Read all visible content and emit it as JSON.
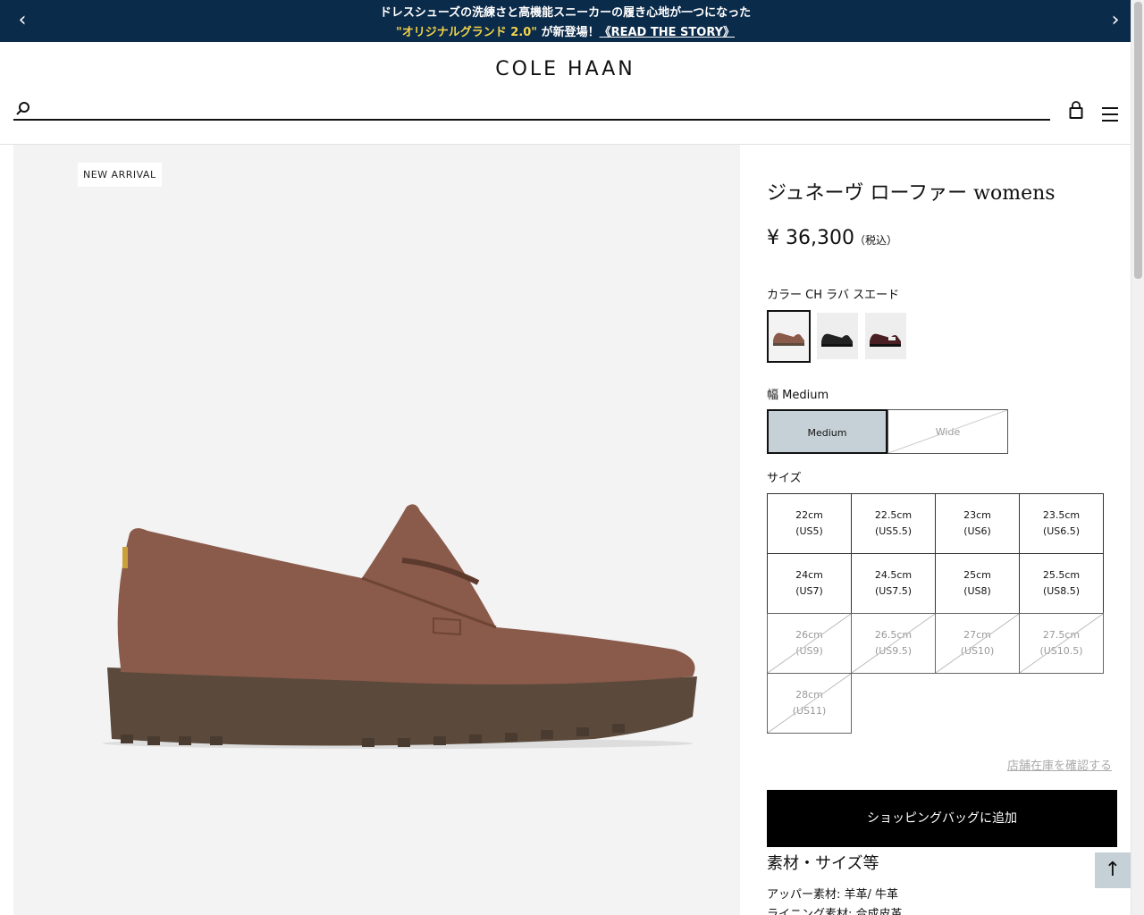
{
  "announcement": {
    "line1": "ドレスシューズの洗練さと高機能スニーカーの履き心地が一つになった",
    "highlight": "\"オリジナルグランド 2.0\"",
    "suffix": " が新登場！",
    "story_link": "《READ THE STORY》",
    "prev_icon": "chevron-left-icon",
    "next_icon": "chevron-right-icon"
  },
  "header": {
    "logo": "COLE HAAN",
    "search_placeholder": "",
    "icons": [
      "search-icon",
      "bag-icon",
      "menu-icon"
    ]
  },
  "gallery": {
    "badge": "NEW ARRIVAL"
  },
  "product": {
    "title": "ジュネーヴ ローファー womens",
    "price": "¥ 36,300",
    "tax_note": "（税込）",
    "color_label": "カラー CH ラバ スエード",
    "swatches": [
      {
        "name": "CH ラバ スエード",
        "selected": true,
        "color": "#8a5a4a"
      },
      {
        "name": "black",
        "selected": false,
        "color": "#222222"
      },
      {
        "name": "burgundy",
        "selected": false,
        "color": "#4a1f24"
      }
    ],
    "width_label": "幅 Medium",
    "width_options": [
      {
        "label": "Medium",
        "selected": true,
        "available": true
      },
      {
        "label": "Wide",
        "selected": false,
        "available": false
      }
    ],
    "size_label": "サイズ",
    "sizes": [
      {
        "cm": "22cm",
        "us": "(US5)",
        "available": true
      },
      {
        "cm": "22.5cm",
        "us": "(US5.5)",
        "available": true
      },
      {
        "cm": "23cm",
        "us": "(US6)",
        "available": true
      },
      {
        "cm": "23.5cm",
        "us": "(US6.5)",
        "available": true
      },
      {
        "cm": "24cm",
        "us": "(US7)",
        "available": true
      },
      {
        "cm": "24.5cm",
        "us": "(US7.5)",
        "available": true
      },
      {
        "cm": "25cm",
        "us": "(US8)",
        "available": true
      },
      {
        "cm": "25.5cm",
        "us": "(US8.5)",
        "available": true
      },
      {
        "cm": "26cm",
        "us": "(US9)",
        "available": false
      },
      {
        "cm": "26.5cm",
        "us": "(US9.5)",
        "available": false
      },
      {
        "cm": "27cm",
        "us": "(US10)",
        "available": false
      },
      {
        "cm": "27.5cm",
        "us": "(US10.5)",
        "available": false
      },
      {
        "cm": "28cm",
        "us": "(US11)",
        "available": false
      }
    ],
    "store_stock_link": "店舗在庫を確認する",
    "add_to_bag": "ショッピングバッグに追加",
    "material_title": "素材・サイズ等",
    "materials": [
      "アッパー素材: 羊革/ 牛革",
      "ライニング素材: 合成皮革"
    ]
  },
  "back_to_top_icon": "arrow-up-icon",
  "colors": {
    "announce_bg": "#0b2b4a",
    "highlight": "#f3d34a",
    "selected_option": "#c6d1d7"
  }
}
